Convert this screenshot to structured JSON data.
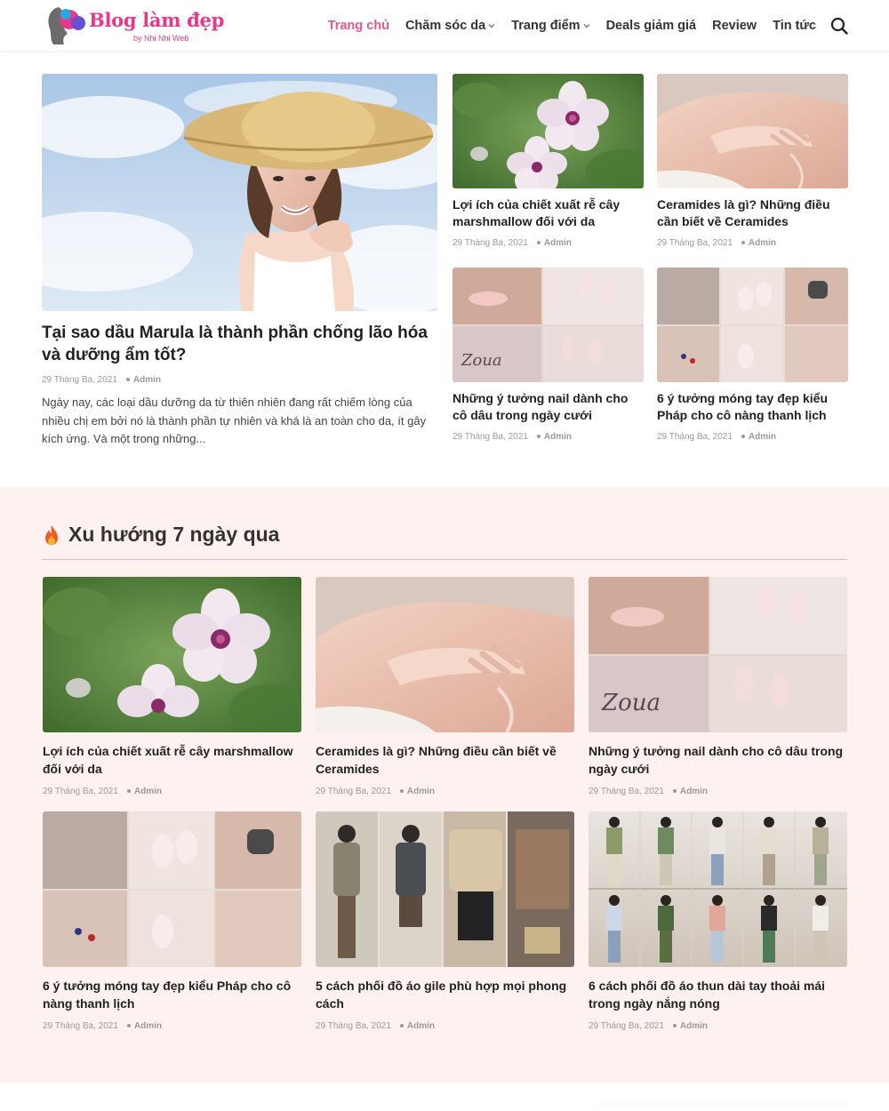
{
  "brand": {
    "name": "Blog làm đẹp",
    "tagline": "by Nhi Nhi Web",
    "color": "#e8388a"
  },
  "nav": {
    "items": [
      {
        "label": "Trang chủ",
        "active": true,
        "has_dropdown": false
      },
      {
        "label": "Chăm sóc da",
        "active": false,
        "has_dropdown": true
      },
      {
        "label": "Trang điểm",
        "active": false,
        "has_dropdown": true
      },
      {
        "label": "Deals giảm giá",
        "active": false,
        "has_dropdown": false
      },
      {
        "label": "Review",
        "active": false,
        "has_dropdown": false
      },
      {
        "label": "Tin tức",
        "active": false,
        "has_dropdown": false
      }
    ],
    "search_icon": "search-icon",
    "active_color": "#e8588d"
  },
  "featured": {
    "main": {
      "title": "Tại sao dầu Marula là thành phần chống lão hóa và dưỡng ẩm tốt?",
      "date": "29 Tháng Ba, 2021",
      "author": "Admin",
      "excerpt": "Ngày nay, các loại dầu dưỡng da từ thiên nhiên đang rất chiếm lòng của nhiều chị em bởi nó là thành phần tự nhiên và khá là an toàn cho da, ít gây kích ứng. Và một trong những...",
      "image": "woman-hat"
    },
    "side": [
      {
        "title": "Lợi ích của chiết xuất rễ cây marshmallow đối với da",
        "date": "29 Tháng Ba, 2021",
        "author": "Admin",
        "image": "flower"
      },
      {
        "title": "Ceramides là gì? Những điều cần biết về Ceramides",
        "date": "29 Tháng Ba, 2021",
        "author": "Admin",
        "image": "shoulder"
      },
      {
        "title": "Những ý tưởng nail dành cho cô dâu trong ngày cưới",
        "date": "29 Tháng Ba, 2021",
        "author": "Admin",
        "image": "nails-bridal"
      },
      {
        "title": "6 ý tưởng móng tay đẹp kiểu Pháp cho cô nàng thanh lịch",
        "date": "29 Tháng Ba, 2021",
        "author": "Admin",
        "image": "nails-french"
      }
    ]
  },
  "trending": {
    "title": "Xu hướng 7 ngày qua",
    "icon": "fire-icon",
    "background": "#fdf2f0",
    "posts": [
      {
        "title": "Lợi ích của chiết xuất rễ cây marshmallow đối với da",
        "date": "29 Tháng Ba, 2021",
        "author": "Admin",
        "image": "flower"
      },
      {
        "title": "Ceramides là gì? Những điều cần biết về Ceramides",
        "date": "29 Tháng Ba, 2021",
        "author": "Admin",
        "image": "shoulder"
      },
      {
        "title": "Những ý tưởng nail dành cho cô dâu trong ngày cưới",
        "date": "29 Tháng Ba, 2021",
        "author": "Admin",
        "image": "nails-bridal"
      },
      {
        "title": "6 ý tưởng móng tay đẹp kiểu Pháp cho cô nàng thanh lịch",
        "date": "29 Tháng Ba, 2021",
        "author": "Admin",
        "image": "nails-french"
      },
      {
        "title": "5 cách phối đồ áo gile phù hợp mọi phong cách",
        "date": "29 Tháng Ba, 2021",
        "author": "Admin",
        "image": "outfits-vest"
      },
      {
        "title": "6 cách phối đồ áo thun dài tay thoải mái trong ngày nắng nóng",
        "date": "29 Tháng Ba, 2021",
        "author": "Admin",
        "image": "outfits-longsleeve"
      }
    ]
  }
}
